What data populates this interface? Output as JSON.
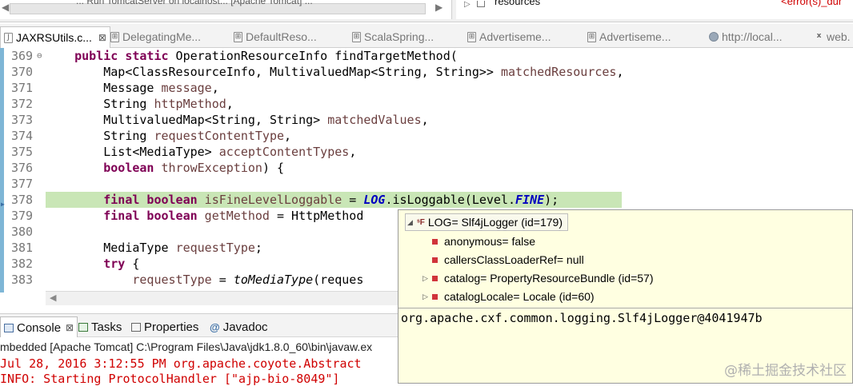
{
  "top": {
    "cut_text": "... Run TomcatServer on localhost... [Apache Tomcat] ...",
    "resources_label": "resources",
    "error_label": "<error(s)_dur"
  },
  "editor_tabs": [
    {
      "label": "JAXRSUtils.c...",
      "icon": "java-file-icon",
      "active": true
    },
    {
      "label": "DelegatingMe...",
      "icon": "class-file-icon"
    },
    {
      "label": "DefaultReso...",
      "icon": "class-file-icon"
    },
    {
      "label": "ScalaSpring...",
      "icon": "class-file-icon"
    },
    {
      "label": "Advertiseme...",
      "icon": "class-file-icon"
    },
    {
      "label": "Advertiseme...",
      "icon": "class-file-icon"
    },
    {
      "label": "http://local...",
      "icon": "globe-icon"
    },
    {
      "label": "web.",
      "icon": "xml-file-icon"
    }
  ],
  "code_lines": [
    {
      "num": "369",
      "fold": "⊖"
    },
    {
      "num": "370"
    },
    {
      "num": "371"
    },
    {
      "num": "372"
    },
    {
      "num": "373"
    },
    {
      "num": "374"
    },
    {
      "num": "375"
    },
    {
      "num": "376"
    },
    {
      "num": "377"
    },
    {
      "num": "378"
    },
    {
      "num": "379"
    },
    {
      "num": "380"
    },
    {
      "num": "381"
    },
    {
      "num": "382"
    },
    {
      "num": "383"
    }
  ],
  "code": {
    "l369": {
      "kw1": "public static",
      "rest": " OperationResourceInfo findTargetMethod("
    },
    "l370": {
      "type": "Map<ClassResourceInfo, MultivaluedMap<String, String>> ",
      "param": "matchedResources",
      "end": ","
    },
    "l371": {
      "type": "Message ",
      "param": "message",
      "end": ","
    },
    "l372": {
      "type": "String ",
      "param": "httpMethod",
      "end": ","
    },
    "l373": {
      "type": "MultivaluedMap<String, String> ",
      "param": "matchedValues",
      "end": ","
    },
    "l374": {
      "type": "String ",
      "param": "requestContentType",
      "end": ","
    },
    "l375": {
      "type": "List<MediaType> ",
      "param": "acceptContentTypes",
      "end": ","
    },
    "l376": {
      "kw": "boolean",
      "param": " throwException",
      "end": ") {"
    },
    "l378": {
      "kw": "final boolean",
      "param": " isFineLevelLoggable",
      "mid": " = ",
      "field": "LOG",
      "call": ".isLoggable(Level.",
      "field2": "FINE",
      "end": ");"
    },
    "l379": {
      "kw": "final boolean",
      "param": " getMethod",
      "end": " = HttpMethod"
    },
    "l381": {
      "type": "MediaType ",
      "param": "requestType",
      "end": ";"
    },
    "l382": {
      "kw": "try",
      "end": " {"
    },
    "l383": {
      "param": "requestType",
      "mid": " = ",
      "method": "toMediaType",
      "end": "(reques"
    }
  },
  "views": {
    "console": "Console",
    "tasks": "Tasks",
    "properties": "Properties",
    "javadoc": "Javadoc"
  },
  "console": {
    "header": "mbedded [Apache Tomcat] C:\\Program Files\\Java\\jdk1.8.0_60\\bin\\javaw.ex",
    "line1": "Jul 28, 2016 3:12:55 PM org.apache.coyote.Abstract",
    "line2": "INFO: Starting ProtocolHandler [\"ajp-bio-8049\"]"
  },
  "popup": {
    "root": "LOG= Slf4jLogger  (id=179)",
    "fields": [
      {
        "label": "anonymous= false",
        "expandable": false
      },
      {
        "label": "callersClassLoaderRef= null",
        "expandable": false
      },
      {
        "label": "catalog= PropertyResourceBundle  (id=57)",
        "expandable": true
      },
      {
        "label": "catalogLocale= Locale  (id=60)",
        "expandable": true
      }
    ],
    "detail": "org.apache.cxf.common.logging.Slf4jLogger@4041947b"
  },
  "watermark": "@稀土掘金技术社区"
}
